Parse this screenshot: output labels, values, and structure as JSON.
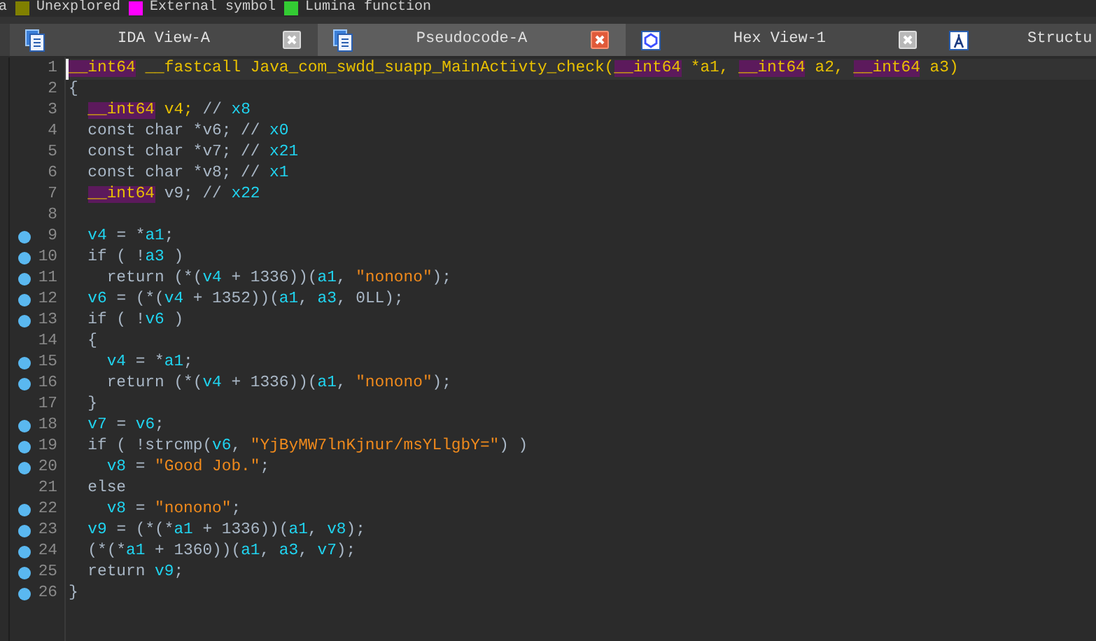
{
  "legend": {
    "fragment": "a",
    "items": [
      {
        "label": "Unexplored",
        "color": "#808000"
      },
      {
        "label": "External symbol",
        "color": "#ff00ff"
      },
      {
        "label": "Lumina function",
        "color": "#33cc33"
      }
    ]
  },
  "tabs": [
    {
      "label": "IDA View-A",
      "kind": "disasm",
      "selected": false
    },
    {
      "label": "Pseudocode-A",
      "kind": "pseudo",
      "selected": true
    },
    {
      "label": "Hex View-1",
      "kind": "hex",
      "selected": false
    },
    {
      "label": "Structu",
      "kind": "struct",
      "selected": false
    }
  ],
  "code": [
    {
      "no": "1",
      "breakpoint": false,
      "current": true,
      "tokens": [
        {
          "kind": "type",
          "text": "__int64"
        },
        {
          "kind": "decl",
          "text": " __fastcall Java_com_swdd_suapp_MainActivty_check("
        },
        {
          "kind": "type",
          "text": "__int64"
        },
        {
          "kind": "decl",
          "text": " *a1, "
        },
        {
          "kind": "type",
          "text": "__int64"
        },
        {
          "kind": "decl",
          "text": " a2, "
        },
        {
          "kind": "type",
          "text": "__int64"
        },
        {
          "kind": "decl",
          "text": " a3)"
        }
      ]
    },
    {
      "no": "2",
      "breakpoint": false,
      "current": false,
      "tokens": [
        {
          "kind": "text",
          "text": "{"
        }
      ]
    },
    {
      "no": "3",
      "breakpoint": false,
      "current": false,
      "tokens": [
        {
          "kind": "type",
          "text": "  __int64"
        },
        {
          "kind": "decl",
          "text": " v4;"
        },
        {
          "kind": "text",
          "text": " // "
        },
        {
          "kind": "var",
          "text": "x8"
        }
      ]
    },
    {
      "no": "4",
      "breakpoint": false,
      "current": false,
      "tokens": [
        {
          "kind": "text",
          "text": "  const char *v6; // "
        },
        {
          "kind": "var",
          "text": "x0"
        }
      ]
    },
    {
      "no": "5",
      "breakpoint": false,
      "current": false,
      "tokens": [
        {
          "kind": "text",
          "text": "  const char *v7; // "
        },
        {
          "kind": "var",
          "text": "x21"
        }
      ]
    },
    {
      "no": "6",
      "breakpoint": false,
      "current": false,
      "tokens": [
        {
          "kind": "text",
          "text": "  const char *v8; // "
        },
        {
          "kind": "var",
          "text": "x1"
        }
      ]
    },
    {
      "no": "7",
      "breakpoint": false,
      "current": false,
      "tokens": [
        {
          "kind": "type",
          "text": "  __int64"
        },
        {
          "kind": "text",
          "text": " v9; // "
        },
        {
          "kind": "var",
          "text": "x22"
        }
      ]
    },
    {
      "no": "8",
      "breakpoint": false,
      "current": false
    },
    {
      "no": "9",
      "breakpoint": true,
      "current": false,
      "tokens": [
        {
          "kind": "var",
          "text": "  v4"
        },
        {
          "kind": "text",
          "text": " = *"
        },
        {
          "kind": "var",
          "text": "a1"
        },
        {
          "kind": "text",
          "text": ";"
        }
      ]
    },
    {
      "no": "10",
      "breakpoint": true,
      "current": false,
      "tokens": [
        {
          "kind": "text",
          "text": "  if ( !"
        },
        {
          "kind": "var",
          "text": "a3"
        },
        {
          "kind": "text",
          "text": " )"
        }
      ]
    },
    {
      "no": "11",
      "breakpoint": true,
      "current": false,
      "tokens": [
        {
          "kind": "text",
          "text": "    return (*("
        },
        {
          "kind": "var",
          "text": "v4"
        },
        {
          "kind": "text",
          "text": " + 1336))("
        },
        {
          "kind": "var",
          "text": "a1"
        },
        {
          "kind": "text",
          "text": ", "
        },
        {
          "kind": "str",
          "text": "\"nonono\""
        },
        {
          "kind": "text",
          "text": ");"
        }
      ]
    },
    {
      "no": "12",
      "breakpoint": true,
      "current": false,
      "tokens": [
        {
          "kind": "var",
          "text": "  v6"
        },
        {
          "kind": "text",
          "text": " = (*("
        },
        {
          "kind": "var",
          "text": "v4"
        },
        {
          "kind": "text",
          "text": " + 1352))("
        },
        {
          "kind": "var",
          "text": "a1"
        },
        {
          "kind": "text",
          "text": ", "
        },
        {
          "kind": "var",
          "text": "a3"
        },
        {
          "kind": "text",
          "text": ", 0LL);"
        }
      ]
    },
    {
      "no": "13",
      "breakpoint": true,
      "current": false,
      "tokens": [
        {
          "kind": "text",
          "text": "  if ( !"
        },
        {
          "kind": "var",
          "text": "v6"
        },
        {
          "kind": "text",
          "text": " )"
        }
      ]
    },
    {
      "no": "14",
      "breakpoint": false,
      "current": false,
      "tokens": [
        {
          "kind": "text",
          "text": "  {"
        }
      ]
    },
    {
      "no": "15",
      "breakpoint": true,
      "current": false,
      "tokens": [
        {
          "kind": "var",
          "text": "    v4"
        },
        {
          "kind": "text",
          "text": " = *"
        },
        {
          "kind": "var",
          "text": "a1"
        },
        {
          "kind": "text",
          "text": ";"
        }
      ]
    },
    {
      "no": "16",
      "breakpoint": true,
      "current": false,
      "tokens": [
        {
          "kind": "text",
          "text": "    return (*("
        },
        {
          "kind": "var",
          "text": "v4"
        },
        {
          "kind": "text",
          "text": " + 1336))("
        },
        {
          "kind": "var",
          "text": "a1"
        },
        {
          "kind": "text",
          "text": ", "
        },
        {
          "kind": "str",
          "text": "\"nonono\""
        },
        {
          "kind": "text",
          "text": ");"
        }
      ]
    },
    {
      "no": "17",
      "breakpoint": false,
      "current": false,
      "tokens": [
        {
          "kind": "text",
          "text": "  }"
        }
      ]
    },
    {
      "no": "18",
      "breakpoint": true,
      "current": false,
      "tokens": [
        {
          "kind": "var",
          "text": "  v7"
        },
        {
          "kind": "text",
          "text": " = "
        },
        {
          "kind": "var",
          "text": "v6"
        },
        {
          "kind": "text",
          "text": ";"
        }
      ]
    },
    {
      "no": "19",
      "breakpoint": true,
      "current": false,
      "tokens": [
        {
          "kind": "text",
          "text": "  if ( !strcmp("
        },
        {
          "kind": "var",
          "text": "v6"
        },
        {
          "kind": "text",
          "text": ", "
        },
        {
          "kind": "str",
          "text": "\"YjByMW7lnKjnur/msYLlgbY=\""
        },
        {
          "kind": "text",
          "text": ") )"
        }
      ]
    },
    {
      "no": "20",
      "breakpoint": true,
      "current": false,
      "tokens": [
        {
          "kind": "var",
          "text": "    v8"
        },
        {
          "kind": "text",
          "text": " = "
        },
        {
          "kind": "str",
          "text": "\"Good Job.\""
        },
        {
          "kind": "text",
          "text": ";"
        }
      ]
    },
    {
      "no": "21",
      "breakpoint": false,
      "current": false,
      "tokens": [
        {
          "kind": "text",
          "text": "  else"
        }
      ]
    },
    {
      "no": "22",
      "breakpoint": true,
      "current": false,
      "tokens": [
        {
          "kind": "var",
          "text": "    v8"
        },
        {
          "kind": "text",
          "text": " = "
        },
        {
          "kind": "str",
          "text": "\"nonono\""
        },
        {
          "kind": "text",
          "text": ";"
        }
      ]
    },
    {
      "no": "23",
      "breakpoint": true,
      "current": false,
      "tokens": [
        {
          "kind": "var",
          "text": "  v9"
        },
        {
          "kind": "text",
          "text": " = (*(*"
        },
        {
          "kind": "var",
          "text": "a1"
        },
        {
          "kind": "text",
          "text": " + 1336))("
        },
        {
          "kind": "var",
          "text": "a1"
        },
        {
          "kind": "text",
          "text": ", "
        },
        {
          "kind": "var",
          "text": "v8"
        },
        {
          "kind": "text",
          "text": ");"
        }
      ]
    },
    {
      "no": "24",
      "breakpoint": true,
      "current": false,
      "tokens": [
        {
          "kind": "text",
          "text": "  (*(*"
        },
        {
          "kind": "var",
          "text": "a1"
        },
        {
          "kind": "text",
          "text": " + 1360))("
        },
        {
          "kind": "var",
          "text": "a1"
        },
        {
          "kind": "text",
          "text": ", "
        },
        {
          "kind": "var",
          "text": "a3"
        },
        {
          "kind": "text",
          "text": ", "
        },
        {
          "kind": "var",
          "text": "v7"
        },
        {
          "kind": "text",
          "text": ");"
        }
      ]
    },
    {
      "no": "25",
      "breakpoint": true,
      "current": false,
      "tokens": [
        {
          "kind": "text",
          "text": "  return "
        },
        {
          "kind": "var",
          "text": "v9"
        },
        {
          "kind": "text",
          "text": ";"
        }
      ]
    },
    {
      "no": "26",
      "breakpoint": true,
      "current": false,
      "tokens": [
        {
          "kind": "text",
          "text": "}"
        }
      ]
    }
  ]
}
